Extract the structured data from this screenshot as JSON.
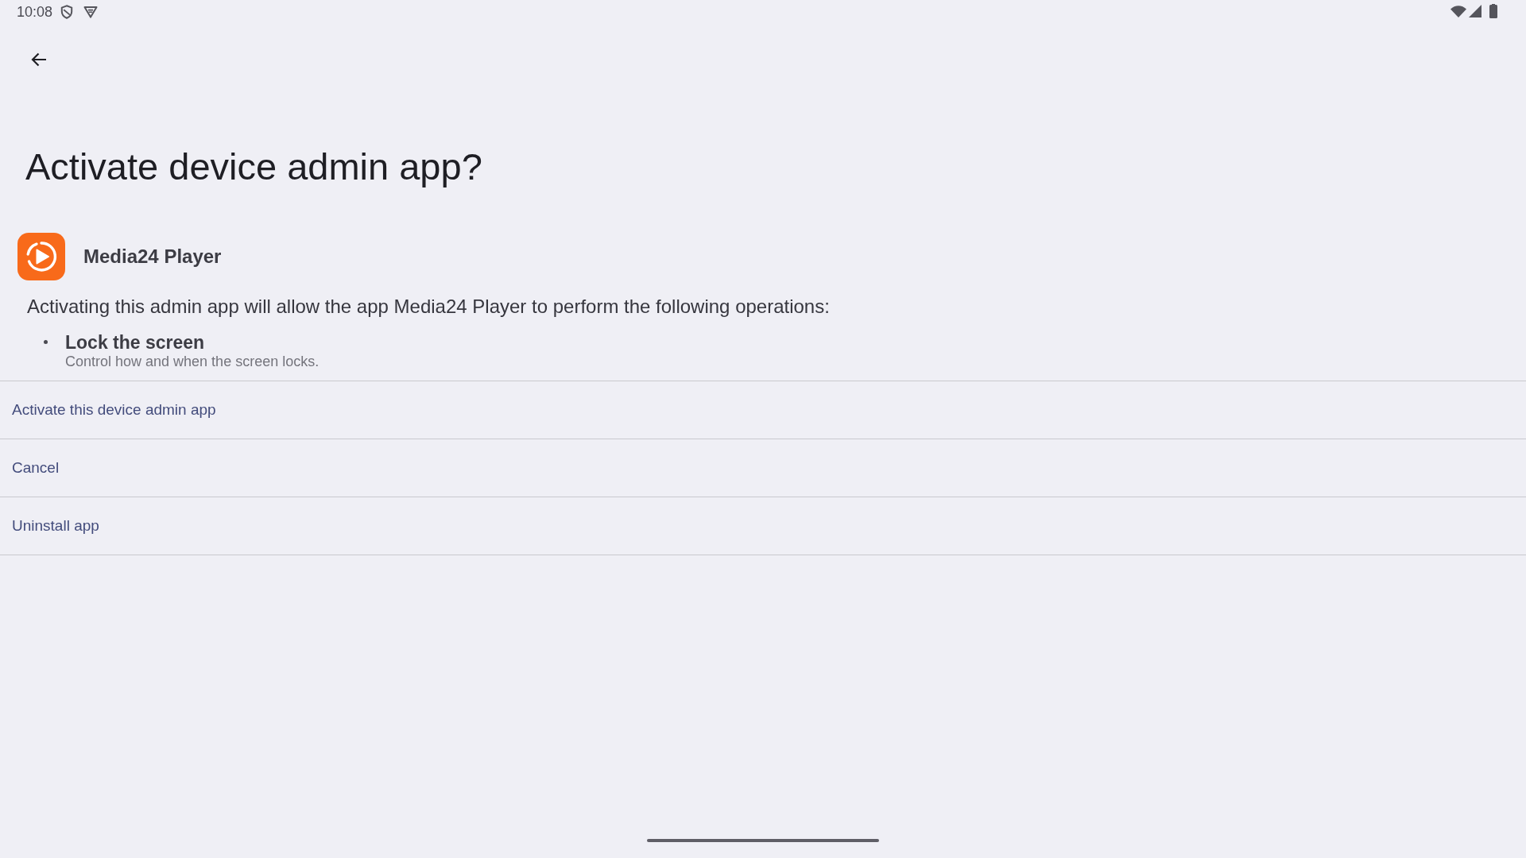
{
  "status_bar": {
    "time": "10:08"
  },
  "title": "Activate device admin app?",
  "app": {
    "name": "Media24 Player"
  },
  "description": "Activating this admin app will allow the app Media24 Player to perform the following operations:",
  "operations": [
    {
      "title": "Lock the screen",
      "description": "Control how and when the screen locks."
    }
  ],
  "actions": [
    "Activate this device admin app",
    "Cancel",
    "Uninstall app"
  ]
}
